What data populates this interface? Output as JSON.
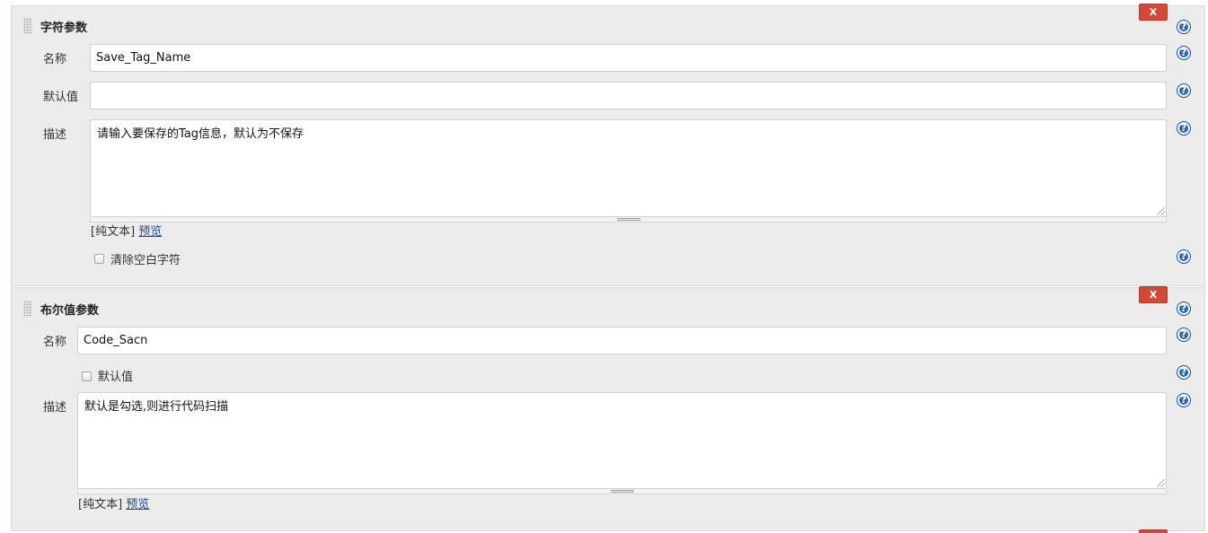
{
  "sections": [
    {
      "title": "字符参数",
      "remove_label": "X",
      "name_label": "名称",
      "name_value": "Save_Tag_Name",
      "default_label": "默认值",
      "default_value": "",
      "desc_label": "描述",
      "desc_value": "请输入要保存的Tag信息，默认为不保存",
      "format_plain": "[纯文本]",
      "format_preview": "预览",
      "trim_label": "清除空白字符"
    },
    {
      "title": "布尔值参数",
      "remove_label": "X",
      "name_label": "名称",
      "name_value": "Code_Sacn",
      "default_label": "默认值",
      "desc_label": "描述",
      "desc_value": "默认是勾选,则进行代码扫描",
      "format_plain": "[纯文本]",
      "format_preview": "预览"
    }
  ],
  "icons": {
    "help": "help-icon",
    "drag": "drag-handle-icon",
    "resize": "resize-icon"
  },
  "colors": {
    "remove_button": "#d24939",
    "help_icon": "#2a68b3",
    "link": "#204a87",
    "panel_bg": "#ececec"
  }
}
